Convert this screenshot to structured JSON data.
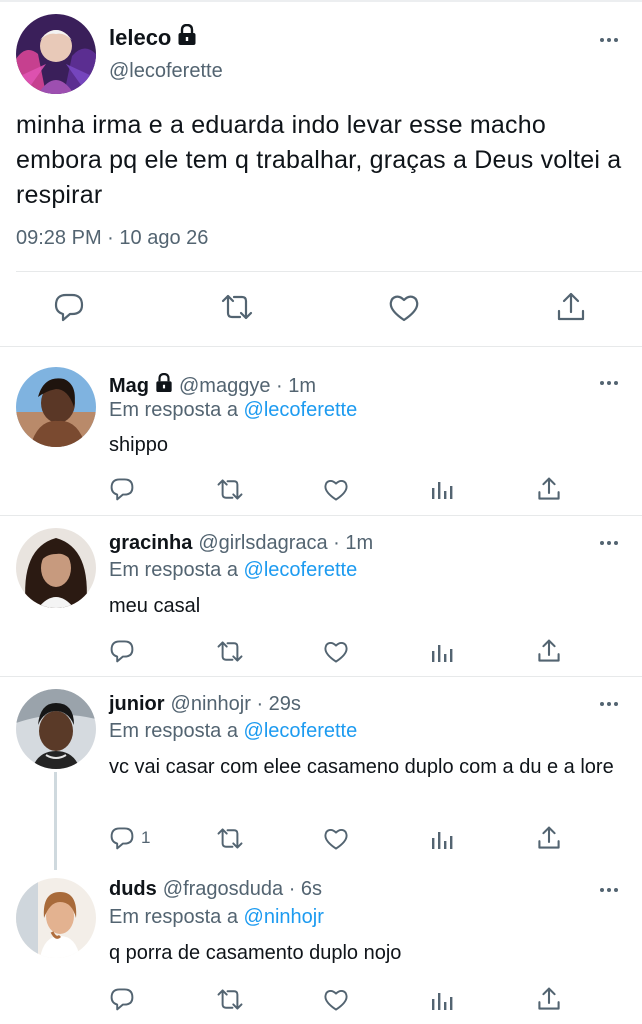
{
  "main_tweet": {
    "display_name": "leleco",
    "handle": "@lecoferette",
    "text": "minha irma e a eduarda indo levar esse macho embora pq ele tem q trabalhar, graças a Deus voltei a respirar",
    "time": "09:28 PM",
    "date": "10 ago 26",
    "separator": "·",
    "icons": [
      "lock-icon",
      "more-icon",
      "reply-icon",
      "retweet-icon",
      "like-icon",
      "share-icon"
    ]
  },
  "replies": [
    {
      "display_name": "Mag",
      "handle_time": "@maggye · 1m",
      "protected": true,
      "reply_prefix": "Em resposta a",
      "reply_to": "@lecoferette",
      "text": "shippo",
      "reply_count": ""
    },
    {
      "display_name": "gracinha",
      "handle_time": "@girlsdagraca · 1m",
      "protected": false,
      "reply_prefix": "Em resposta a",
      "reply_to": "@lecoferette",
      "text": "meu casal",
      "reply_count": ""
    },
    {
      "display_name": "junior",
      "handle_time": "@ninhojr · 29s",
      "protected": false,
      "reply_prefix": "Em resposta a",
      "reply_to": "@lecoferette",
      "text": "vc vai casar com elee casameno duplo com a du e a lore",
      "reply_count": "1"
    },
    {
      "display_name": "duds",
      "handle_time": "@fragosduda · 6s",
      "protected": false,
      "reply_prefix": "Em resposta a",
      "reply_to": "@ninhojr",
      "text": "q porra de casamento duplo nojo",
      "reply_count": ""
    }
  ],
  "colors": {
    "text": "#0f1419",
    "secondary": "#536471",
    "link": "#1d9bf0",
    "divider": "#e7e9ea",
    "thread_line": "#cfd9de"
  }
}
